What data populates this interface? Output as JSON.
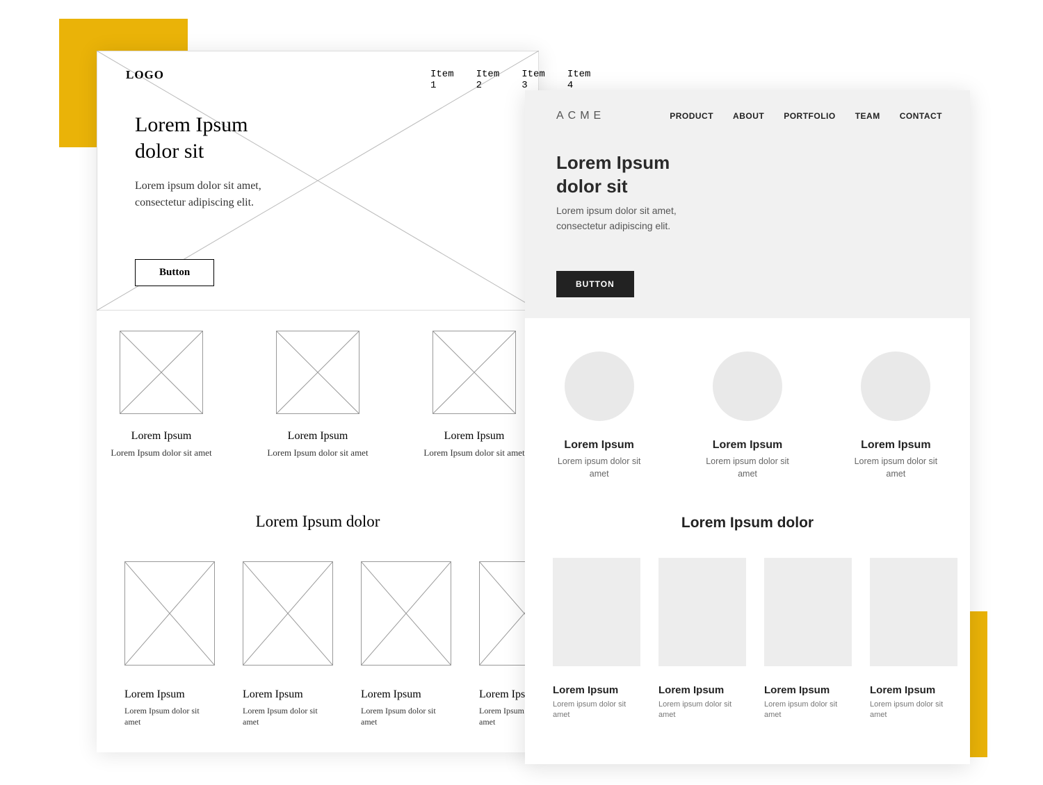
{
  "wireframe": {
    "logo": "LOGO",
    "nav": [
      "Item 1",
      "Item 2",
      "Item 3",
      "Item 4"
    ],
    "hero": {
      "title": "Lorem Ipsum\ndolor sit",
      "subtitle": "Lorem ipsum dolor sit amet,\nconsectetur adipiscing elit.",
      "button": "Button"
    },
    "features": [
      {
        "title": "Lorem Ipsum",
        "sub": "Lorem Ipsum dolor sit amet"
      },
      {
        "title": "Lorem Ipsum",
        "sub": "Lorem Ipsum dolor sit amet"
      },
      {
        "title": "Lorem Ipsum",
        "sub": "Lorem Ipsum dolor sit amet"
      }
    ],
    "section_title": "Lorem Ipsum dolor",
    "portfolio": [
      {
        "title": "Lorem Ipsum",
        "sub": "Lorem Ipsum dolor sit amet"
      },
      {
        "title": "Lorem Ipsum",
        "sub": "Lorem Ipsum dolor sit amet"
      },
      {
        "title": "Lorem Ipsum",
        "sub": "Lorem Ipsum dolor sit amet"
      },
      {
        "title": "Lorem Ipsum",
        "sub": "Lorem Ipsum dolor sit amet"
      }
    ]
  },
  "mockup": {
    "logo": "ACME",
    "nav": [
      "PRODUCT",
      "ABOUT",
      "PORTFOLIO",
      "TEAM",
      "CONTACT"
    ],
    "hero": {
      "title": "Lorem Ipsum\ndolor sit",
      "subtitle": "Lorem ipsum dolor sit amet,\nconsectetur adipiscing elit.",
      "button": "BUTTON"
    },
    "features": [
      {
        "title": "Lorem Ipsum",
        "sub": "Lorem ipsum dolor sit amet"
      },
      {
        "title": "Lorem Ipsum",
        "sub": "Lorem ipsum dolor sit amet"
      },
      {
        "title": "Lorem Ipsum",
        "sub": "Lorem ipsum dolor sit amet"
      }
    ],
    "section_title": "Lorem Ipsum dolor",
    "portfolio": [
      {
        "title": "Lorem Ipsum",
        "sub": "Lorem ipsum dolor sit amet"
      },
      {
        "title": "Lorem Ipsum",
        "sub": "Lorem ipsum dolor sit amet"
      },
      {
        "title": "Lorem Ipsum",
        "sub": "Lorem ipsum dolor sit amet"
      },
      {
        "title": "Lorem Ipsum",
        "sub": "Lorem ipsum dolor sit amet"
      }
    ]
  }
}
